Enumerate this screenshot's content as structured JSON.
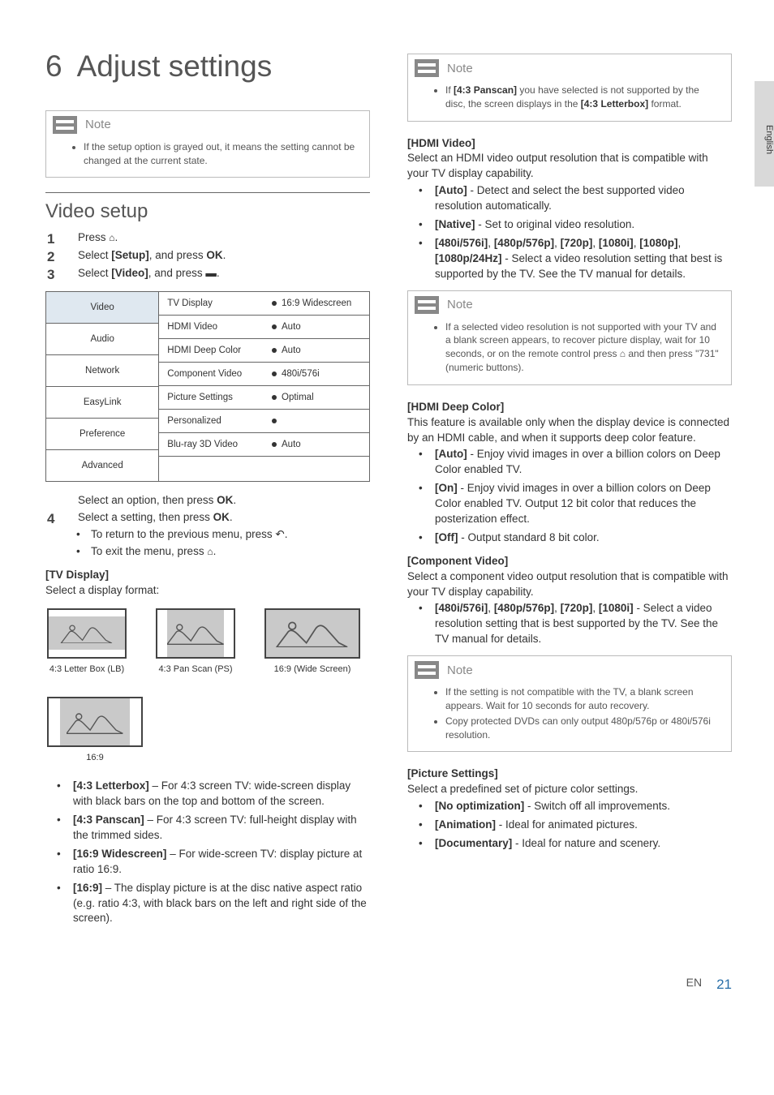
{
  "side_tab": "English",
  "chapter_num": "6",
  "chapter_title": "Adjust settings",
  "note_label": "Note",
  "col_left": {
    "note1": "If the setup option is grayed out, it means the setting cannot be changed at the current state.",
    "section": "Video setup",
    "step1_a": "Press ",
    "step1_b": ".",
    "step2_a": "Select ",
    "step2_b": "[Setup]",
    "step2_c": ", and press ",
    "step2_d": "OK",
    "step2_e": ".",
    "step3_a": "Select ",
    "step3_b": "[Video]",
    "step3_c": ", and press ",
    "step3_d": ".",
    "menu_left": [
      "Video",
      "Audio",
      "Network",
      "EasyLink",
      "Preference",
      "Advanced"
    ],
    "menu_right": [
      {
        "l": "TV Display",
        "v": "16:9 Widescreen"
      },
      {
        "l": "HDMI Video",
        "v": "Auto"
      },
      {
        "l": "HDMI Deep Color",
        "v": "Auto"
      },
      {
        "l": "Component Video",
        "v": "480i/576i"
      },
      {
        "l": "Picture Settings",
        "v": "Optimal"
      },
      {
        "l": "Personalized",
        "v": ""
      },
      {
        "l": "Blu-ray 3D Video",
        "v": "Auto"
      },
      {
        "l": "",
        "v": ""
      }
    ],
    "post1_a": "Select an option, then press ",
    "post1_b": "OK",
    "post1_c": ".",
    "step4_a": "Select a setting, then press ",
    "step4_b": "OK",
    "step4_c": ".",
    "sub1_a": "To return to the previous menu, press ",
    "sub1_b": ".",
    "sub2_a": "To exit the menu, press ",
    "sub2_b": ".",
    "tvdisplay_h": "[TV Display]",
    "tvdisplay_t": "Select a display format:",
    "thumb1": "4:3 Letter Box (LB)",
    "thumb2": "4:3 Pan Scan (PS)",
    "thumb3": "16:9 (Wide Screen)",
    "thumb4": "16:9",
    "b1_h": "[4:3 Letterbox]",
    "b1_t": " – For 4:3 screen TV: wide-screen display with black bars on the top and bottom of the screen.",
    "b2_h": "[4:3 Panscan]",
    "b2_t": " – For 4:3 screen TV: full-height display with the trimmed sides.",
    "b3_h": "[16:9 Widescreen]",
    "b3_t": " – For wide-screen TV: display picture at ratio 16:9.",
    "b4_h": "[16:9]",
    "b4_t": " – The display picture is at the disc native aspect ratio (e.g. ratio 4:3, with black bars on the left and right side of the screen)."
  },
  "col_right": {
    "note1_a": "If ",
    "note1_b": "[4:3 Panscan]",
    "note1_c": " you have selected is not supported by the disc, the screen displays in the ",
    "note1_d": "[4:3 Letterbox]",
    "note1_e": " format.",
    "hdmi_h": "[HDMI Video]",
    "hdmi_t": "Select an HDMI video output resolution that is compatible with your TV display capability.",
    "hb1_h": "[Auto]",
    "hb1_t": " - Detect and select the best supported video resolution automatically.",
    "hb2_h": "[Native]",
    "hb2_t": " - Set to original video resolution.",
    "hb3_h1": "[480i/576i]",
    "hb3_h2": "[480p/576p]",
    "hb3_h3": "[720p]",
    "hb3_h4": "[1080i]",
    "hb3_h5": "[1080p]",
    "hb3_h6": "[1080p/24Hz]",
    "hb3_t": " - Select a video resolution setting that best is supported by the TV. See the TV manual for details.",
    "note2_a": "If a selected video resolution is not supported with your TV and a blank screen appears, to recover picture display, wait for 10 seconds, or on the remote control press ",
    "note2_b": " and then press \"731\" (numeric buttons).",
    "deep_h": "[HDMI Deep Color]",
    "deep_t": "This feature is available only when the display device is connected by an HDMI cable, and when it supports deep color feature.",
    "db1_h": "[Auto]",
    "db1_t": " - Enjoy vivid images in over a billion colors on Deep Color enabled TV.",
    "db2_h": "[On]",
    "db2_t": " - Enjoy vivid images in over a billion colors on Deep Color enabled TV. Output 12 bit color that reduces the posterization effect.",
    "db3_h": "[Off]",
    "db3_t": " - Output standard 8 bit color.",
    "comp_h": "[Component Video]",
    "comp_t": "Select a component video output resolution that is compatible with your TV display capability.",
    "cb1_h1": "[480i/576i]",
    "cb1_h2": "[480p/576p]",
    "cb1_h3": "[720p]",
    "cb1_h4": "[1080i]",
    "cb1_t": " - Select a video resolution setting that is best supported by the TV. See the TV manual for details.",
    "note3_a": "If the setting is not compatible with the TV, a blank screen appears. Wait for 10 seconds for auto recovery.",
    "note3_b": "Copy protected DVDs can only output 480p/576p or 480i/576i resolution.",
    "pic_h": "[Picture Settings]",
    "pic_t": "Select a predefined set of picture color settings.",
    "pb1_h": "[No optimization]",
    "pb1_t": " - Switch off all improvements.",
    "pb2_h": "[Animation]",
    "pb2_t": " - Ideal for animated pictures.",
    "pb3_h": "[Documentary]",
    "pb3_t": " - Ideal for nature and scenery."
  },
  "footer_lang": "EN",
  "footer_page": "21"
}
